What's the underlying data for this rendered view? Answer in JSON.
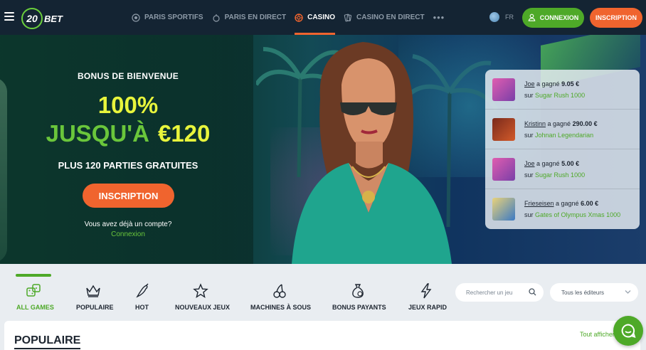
{
  "header": {
    "logo_number": "20",
    "logo_text": "BET",
    "nav": [
      {
        "label": "PARIS SPORTIFS",
        "icon": "soccer-ball-icon",
        "active": false
      },
      {
        "label": "PARIS EN DIRECT",
        "icon": "live-ball-icon",
        "active": false
      },
      {
        "label": "CASINO",
        "icon": "casino-chip-icon",
        "active": true
      },
      {
        "label": "CASINO EN DIRECT",
        "icon": "live-cards-icon",
        "active": false
      }
    ],
    "more": "•••",
    "language": "FR",
    "login_label": "CONNEXION",
    "register_label": "INSCRIPTION"
  },
  "hero": {
    "welcome": "BONUS DE BIENVENUE",
    "percent": "100%",
    "up_to": "JUSQU'À",
    "amount": "€120",
    "free_spins": "PLUS 120 PARTIES GRATUITES",
    "cta": "INSCRIPTION",
    "have_account": "Vous avez déjà un compte?",
    "login_link": "Connexion"
  },
  "winners": [
    {
      "name": "Joe",
      "won_text": "a gagné",
      "amount": "9.05 €",
      "on": "sur",
      "game": "Sugar Rush 1000"
    },
    {
      "name": "Kristinn",
      "won_text": "a gagné",
      "amount": "290.00 €",
      "on": "sur",
      "game": "Johnan Legendarian"
    },
    {
      "name": "Joe",
      "won_text": "a gagné",
      "amount": "5.00 €",
      "on": "sur",
      "game": "Sugar Rush 1000"
    },
    {
      "name": "Frieseisen",
      "won_text": "a gagné",
      "amount": "6.00 €",
      "on": "sur",
      "game": "Gates of Olympus Xmas 1000"
    }
  ],
  "categories": [
    {
      "label": "ALL GAMES",
      "icon": "dice-icon",
      "active": true
    },
    {
      "label": "POPULAIRE",
      "icon": "crown-icon",
      "active": false
    },
    {
      "label": "HOT",
      "icon": "chili-icon",
      "active": false
    },
    {
      "label": "NOUVEAUX JEUX",
      "icon": "star-icon",
      "active": false
    },
    {
      "label": "MACHINES À SOUS",
      "icon": "cherries-icon",
      "active": false
    },
    {
      "label": "BONUS PAYANTS",
      "icon": "money-bag-icon",
      "active": false
    },
    {
      "label": "JEUX RAPID",
      "icon": "lightning-icon",
      "active": false
    }
  ],
  "search": {
    "placeholder": "Rechercher un jeu"
  },
  "provider_select": {
    "value": "Tous les éditeurs"
  },
  "section": {
    "title": "POPULAIRE",
    "see_all": "Tout afficher"
  },
  "colors": {
    "header_bg": "#142433",
    "accent_green": "#4ea928",
    "accent_orange": "#f0642e",
    "bonus_yellow": "#e8f53c"
  }
}
